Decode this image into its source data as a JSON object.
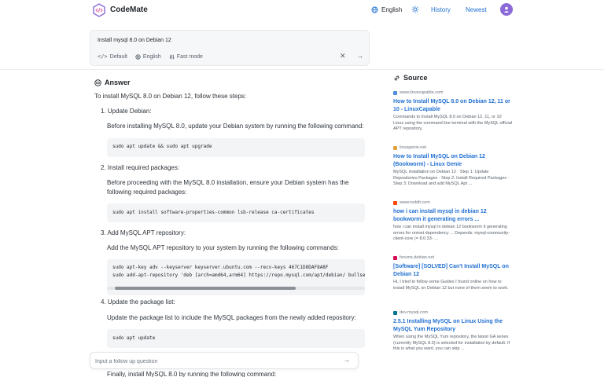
{
  "header": {
    "brand": "CodeMate",
    "language": "English",
    "history": "History",
    "newest": "Newest"
  },
  "query": {
    "text": "Install mysql 8.0 on Debian 12",
    "tools": {
      "default": "Default",
      "language": "English",
      "fast_mode": "Fast mode"
    }
  },
  "answer": {
    "heading": "Answer",
    "intro": "To install MySQL 8.0 on Debian 12, follow these steps:",
    "steps": [
      {
        "title": "1. Update Debian:",
        "text": "Before installing MySQL 8.0, update your Debian system by running the following command:",
        "code": [
          "sudo apt update && sudo apt upgrade"
        ]
      },
      {
        "title": "2. Install required packages:",
        "text": "Before proceeding with the MySQL 8.0 installation, ensure your Debian system has the following required packages:",
        "code": [
          "sudo apt install software-properties-common lsb-release ca-certificates"
        ]
      },
      {
        "title": "3. Add MySQL APT repository:",
        "text": "Add the MySQL APT repository to your system by running the following commands:",
        "code": [
          "sudo apt-key adv --keyserver keyserver.ubuntu.com --recv-keys 467C1D8DAF8A8F",
          "sudo add-apt-repository 'deb [arch=amd64,arm64] https://repo.mysql.com/apt/debian/ bullse"
        ]
      },
      {
        "title": "4. Update the package list:",
        "text": "Update the package list to include the MySQL packages from the newly added repository:",
        "code": [
          "sudo apt update"
        ]
      }
    ],
    "finally": "Finally, install MySQL 8.0 by running the following command:"
  },
  "followup": {
    "placeholder": "Input a follow up question"
  },
  "sources": {
    "heading": "Source",
    "items": [
      {
        "domain": "www.linuxcapable.com",
        "favicon_color": "#4a8fd8",
        "title": "How to Install MySQL 8.0 on Debian 12, 11 or 10 - LinuxCapable",
        "snippet": "Commands to Install MySQL 8.0 on Debian 12, 11, or 10 Linux using the command line terminal with the MySQL official APT repository."
      },
      {
        "domain": "linuxgenie.net",
        "favicon_color": "#e0a23a",
        "title": "How to Install MySQL on Debian 12 (Bookworm) - Linux Genie",
        "snippet": "MySQL installation on Debian 12 · Step 1: Update Repositories Packages · Step 2: Install Required Packages · Step 3: Download and add MySQL Apt ..."
      },
      {
        "domain": "www.reddit.com",
        "favicon_color": "#ff4500",
        "title": "how i can install mysql in debian 12 bookworm it generating errors ...",
        "snippet": "how i can install mysql in debian 12 bookworm it generating errors for unmet dependency ... Depends: mysql-community-client-core (= 8.0.33- ..."
      },
      {
        "domain": "forums.debian.net",
        "favicon_color": "#d70a53",
        "title": "[Software] [SOLVED] Can't Install MySQL on Debian 12",
        "snippet": "Hi, I tried to follow some Guides I found online on how to install MySQL on Debian 12 but none of them seem to work."
      },
      {
        "domain": "dev.mysql.com",
        "favicon_color": "#00758f",
        "title": "2.5.1 Installing MySQL on Linux Using the MySQL Yum Repository",
        "snippet": "When using the MySQL Yum repository, the latest GA series (currently MySQL 8.0) is selected for installation by default. If this is what you want, you can skip ..."
      }
    ]
  }
}
